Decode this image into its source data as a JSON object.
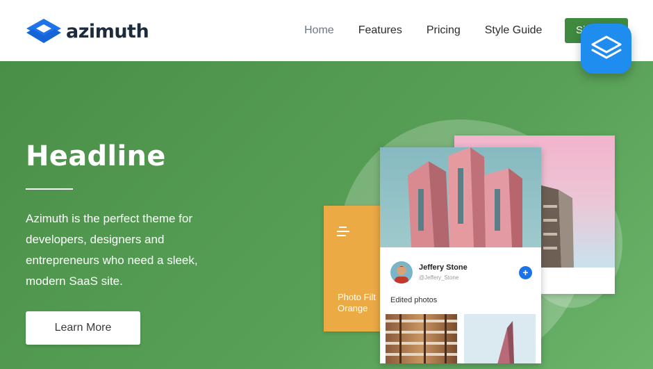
{
  "brand": {
    "name": "azimuth",
    "logo_icon": "azimuth-logo-icon",
    "logo_color": "#1e73e8",
    "text_color": "#1d2b3c"
  },
  "nav": {
    "items": [
      {
        "label": "Home",
        "active": true
      },
      {
        "label": "Features",
        "active": false
      },
      {
        "label": "Pricing",
        "active": false
      },
      {
        "label": "Style Guide",
        "active": false
      }
    ],
    "signup_label": "Si"
  },
  "hero": {
    "title": "Headline",
    "description": "Azimuth is the perfect theme for developers, designers and entrepreneurs who need a sleek, modern SaaS site.",
    "cta_label": "Learn More",
    "background_color": "#4f9a4f"
  },
  "illustration": {
    "profile_name": "Jeffery Stone",
    "profile_handle": "@Jeffery_Stone",
    "add_icon": "+",
    "edited_label": "Edited photos",
    "orange_card_title_line1": "Photo Filt",
    "orange_card_title_line2": "Orange",
    "orange_color": "#ecaa45"
  },
  "float_badge": {
    "icon": "layers-icon",
    "color": "#1f8df0"
  }
}
